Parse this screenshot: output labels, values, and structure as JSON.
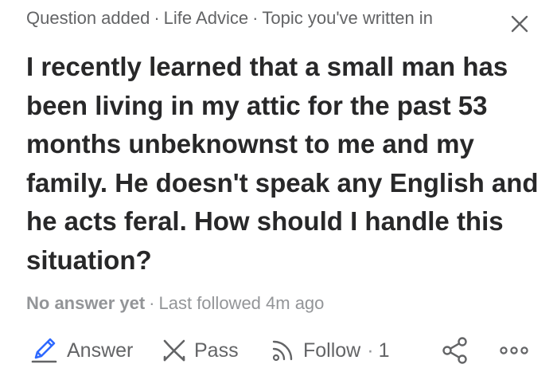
{
  "header": {
    "activity": "Question added",
    "space": "Life Advice",
    "topic_note": "Topic you've written in",
    "separator": "·"
  },
  "question": {
    "text": "I recently learned that a small man has been living in my attic for the past 53 months unbeknownst to me and my family. He doesn't speak any English and he acts feral. How should I handle this situation?"
  },
  "status": {
    "answers": "No answer yet",
    "separator": "·",
    "last_followed": "Last followed 4m ago"
  },
  "actions": {
    "answer_label": "Answer",
    "pass_label": "Pass",
    "follow_label": "Follow",
    "follow_separator": "·",
    "follow_count": "1"
  },
  "icons": {
    "close": "close-icon",
    "answer": "pencil-icon",
    "pass": "pass-x-icon",
    "follow": "follow-rss-icon",
    "share": "share-icon",
    "more": "more-dots-icon"
  },
  "colors": {
    "primary_text": "#282829",
    "secondary_text": "#636466",
    "muted_text": "#939598",
    "accent_blue": "#2e69ff",
    "background": "#ffffff"
  }
}
